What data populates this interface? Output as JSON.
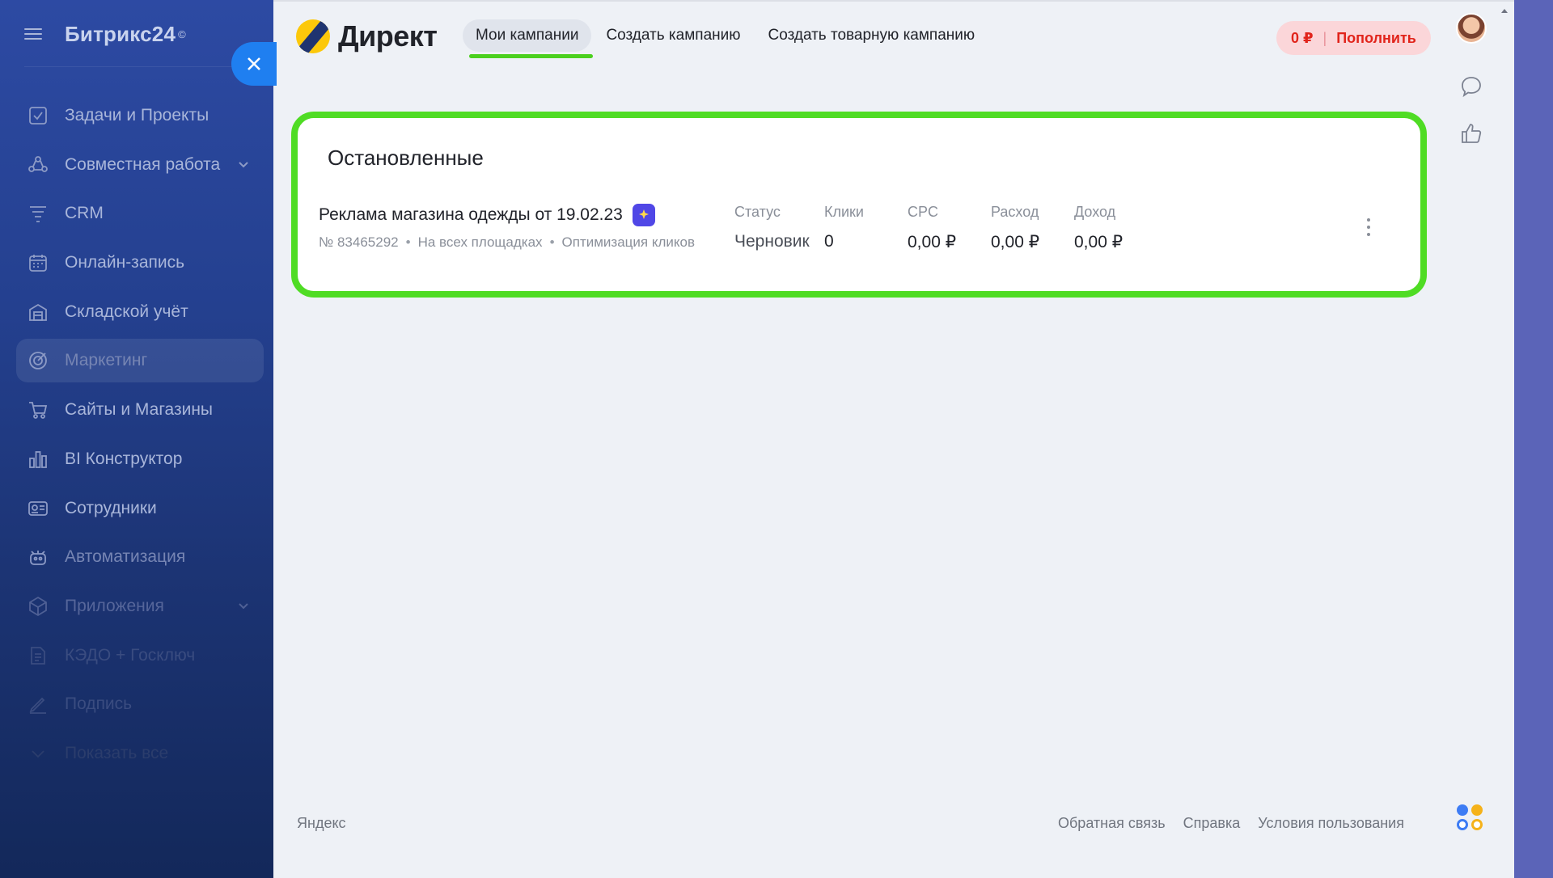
{
  "bitrix": {
    "logo": "Битрикс24",
    "logo_sup": "©",
    "menu": [
      {
        "label": "Задачи и Проекты",
        "icon": "tasks-icon"
      },
      {
        "label": "Совместная работа",
        "icon": "collab-icon"
      },
      {
        "label": "CRM",
        "icon": "crm-icon"
      },
      {
        "label": "Онлайн-запись",
        "icon": "calendar-icon"
      },
      {
        "label": "Складской учёт",
        "icon": "warehouse-icon"
      },
      {
        "label": "Маркетинг",
        "icon": "marketing-icon"
      },
      {
        "label": "Сайты и Магазины",
        "icon": "cart-icon"
      },
      {
        "label": "BI Конструктор",
        "icon": "bar-chart-icon"
      },
      {
        "label": "Сотрудники",
        "icon": "employees-icon"
      },
      {
        "label": "Автоматизация",
        "icon": "robot-icon"
      },
      {
        "label": "Приложения",
        "icon": "apps-icon"
      },
      {
        "label": "КЭДО + Госключ",
        "icon": "document-icon"
      },
      {
        "label": "Подпись",
        "icon": "signature-icon"
      },
      {
        "label": "Показать все",
        "icon": "chevron-down-icon"
      }
    ]
  },
  "direct": {
    "title": "Директ",
    "tabs": [
      "Мои кампании",
      "Создать кампанию",
      "Создать товарную кампанию"
    ],
    "balance": {
      "amount": "0 ₽",
      "separator": "|",
      "topup": "Пополнить"
    }
  },
  "card": {
    "title": "Остановленные",
    "campaign": {
      "name": "Реклама магазина одежды от 19.02.23",
      "number": "№ 83465292",
      "placement": "На всех площадках",
      "strategy": "Оптимизация кликов",
      "dot": "•"
    },
    "columns": [
      {
        "header": "Статус",
        "value": "Черновик"
      },
      {
        "header": "Клики",
        "value": "0"
      },
      {
        "header": "CPC",
        "value": "0,00 ₽"
      },
      {
        "header": "Расход",
        "value": "0,00 ₽"
      },
      {
        "header": "Доход",
        "value": "0,00 ₽"
      }
    ]
  },
  "footer": {
    "brand": "Яндекс",
    "links": [
      "Обратная связь",
      "Справка",
      "Условия пользования"
    ]
  },
  "colors": {
    "highlight_green": "#4fdc24",
    "balance_red": "#e1241b",
    "close_blue": "#1f7ff0",
    "badge_purple": "#5047e6"
  }
}
